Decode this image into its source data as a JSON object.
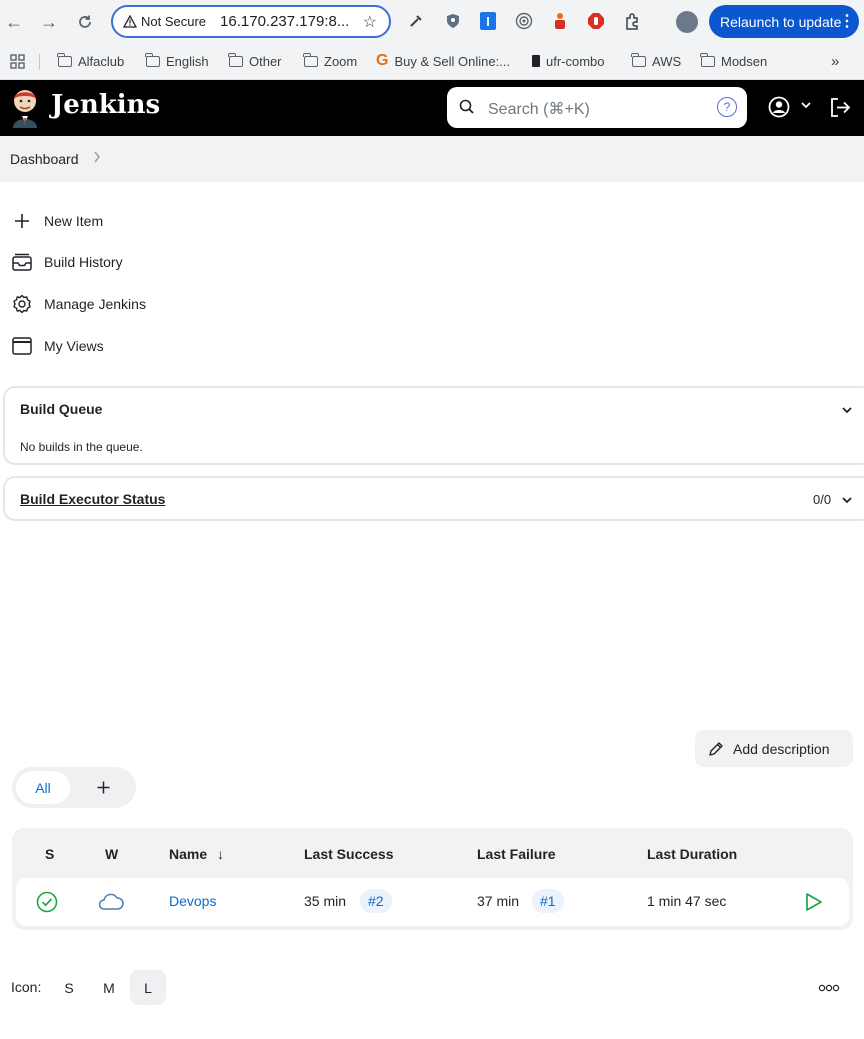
{
  "browser": {
    "not_secure_label": "Not Secure",
    "url": "16.170.237.179:8...",
    "relaunch_label": "Relaunch to update"
  },
  "bookmarks": [
    {
      "label": "Alfaclub",
      "icon": "folder-icon"
    },
    {
      "label": "English",
      "icon": "folder-icon"
    },
    {
      "label": "Other",
      "icon": "folder-icon"
    },
    {
      "label": "Zoom",
      "icon": "folder-icon"
    },
    {
      "label": "Buy & Sell Online:...",
      "icon": "site-icon"
    },
    {
      "label": "ufr-combo",
      "icon": "page-icon"
    },
    {
      "label": "AWS",
      "icon": "folder-icon"
    },
    {
      "label": "Modsen",
      "icon": "folder-icon"
    }
  ],
  "header": {
    "title": "Jenkins",
    "search_placeholder": "Search (⌘+K)",
    "help_glyph": "?"
  },
  "breadcrumb": {
    "items": [
      "Dashboard"
    ]
  },
  "tasks": [
    {
      "label": "New Item",
      "icon": "plus-icon"
    },
    {
      "label": "Build History",
      "icon": "history-icon"
    },
    {
      "label": "Manage Jenkins",
      "icon": "gear-icon"
    },
    {
      "label": "My Views",
      "icon": "window-icon"
    }
  ],
  "build_queue": {
    "title": "Build Queue",
    "empty_text": "No builds in the queue."
  },
  "executor_status": {
    "title": "Build Executor Status",
    "count": "0/0"
  },
  "main": {
    "add_description_label": "Add description",
    "tabs": [
      {
        "label": "All",
        "active": true
      }
    ],
    "add_tab_glyph": "+"
  },
  "jobs_table": {
    "headers": {
      "status": "S",
      "weather": "W",
      "name": "Name",
      "name_sort": "↓",
      "last_success": "Last Success",
      "last_failure": "Last Failure",
      "last_duration": "Last Duration"
    },
    "rows": [
      {
        "status": "success",
        "weather": "cloudy",
        "name": "Devops",
        "last_success_time": "35 min",
        "last_success_build": "#2",
        "last_failure_time": "37 min",
        "last_failure_build": "#1",
        "last_duration": "1 min 47 sec"
      }
    ]
  },
  "icon_size": {
    "label": "Icon:",
    "options": [
      "S",
      "M",
      "L"
    ],
    "selected": "L"
  },
  "colors": {
    "accent": "#0b6bcb",
    "success": "#1ea446",
    "header_bg": "#000000"
  }
}
